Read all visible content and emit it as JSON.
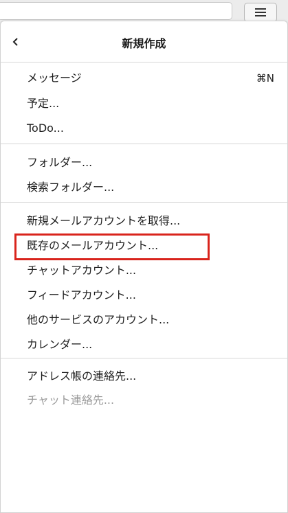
{
  "header": {
    "title": "新規作成",
    "back_icon": "chevron-left-icon",
    "menu_icon": "hamburger-menu-icon"
  },
  "groups": [
    {
      "items": [
        {
          "label": "メッセージ",
          "shortcut": "⌘N",
          "disabled": false
        },
        {
          "label": "予定...",
          "disabled": false
        },
        {
          "label": "ToDo...",
          "disabled": false
        }
      ]
    },
    {
      "items": [
        {
          "label": "フォルダー...",
          "disabled": false
        },
        {
          "label": "検索フォルダー...",
          "disabled": false
        }
      ]
    },
    {
      "items": [
        {
          "label": "新規メールアカウントを取得...",
          "disabled": false
        },
        {
          "label": "既存のメールアカウント...",
          "disabled": false
        },
        {
          "label": "チャットアカウント...",
          "disabled": false
        },
        {
          "label": "フィードアカウント...",
          "disabled": false
        },
        {
          "label": "他のサービスのアカウント...",
          "disabled": false
        },
        {
          "label": "カレンダー...",
          "disabled": false
        }
      ]
    },
    {
      "items": [
        {
          "label": "アドレス帳の連絡先...",
          "disabled": false
        },
        {
          "label": "チャット連絡先...",
          "disabled": true
        }
      ]
    }
  ],
  "highlight_color": "#d9241c"
}
